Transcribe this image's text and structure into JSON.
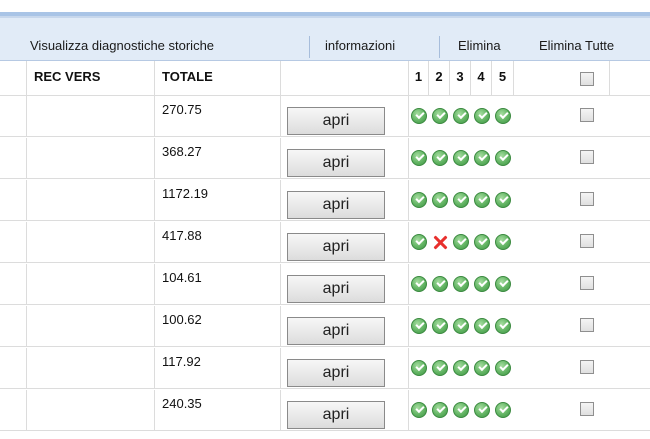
{
  "toolbar": {
    "items": [
      {
        "label": "Visualizza diagnostiche storiche"
      },
      {
        "label": "informazioni"
      },
      {
        "label": "Elimina"
      },
      {
        "label": "Elimina Tutte"
      }
    ]
  },
  "table": {
    "columns": {
      "rec_vers": "REC VERS",
      "totale": "TOTALE",
      "d1": "1",
      "d2": "2",
      "d3": "3",
      "d4": "4",
      "d5": "5"
    },
    "button_label": "apri",
    "rows": [
      {
        "totale": "270.75",
        "status": [
          "ok",
          "ok",
          "ok",
          "ok",
          "ok"
        ]
      },
      {
        "totale": "368.27",
        "status": [
          "ok",
          "ok",
          "ok",
          "ok",
          "ok"
        ]
      },
      {
        "totale": "1172.19",
        "status": [
          "ok",
          "ok",
          "ok",
          "ok",
          "ok"
        ]
      },
      {
        "totale": "417.88",
        "status": [
          "ok",
          "error",
          "ok",
          "ok",
          "ok"
        ]
      },
      {
        "totale": "104.61",
        "status": [
          "ok",
          "ok",
          "ok",
          "ok",
          "ok"
        ]
      },
      {
        "totale": "100.62",
        "status": [
          "ok",
          "ok",
          "ok",
          "ok",
          "ok"
        ]
      },
      {
        "totale": "117.92",
        "status": [
          "ok",
          "ok",
          "ok",
          "ok",
          "ok"
        ]
      },
      {
        "totale": "240.35",
        "status": [
          "ok",
          "ok",
          "ok",
          "ok",
          "ok"
        ]
      }
    ]
  },
  "colors": {
    "toolbar_bg": "#e1ebf7",
    "ok_green": "#62b463",
    "error_red": "#e8302d"
  },
  "icons": {
    "ok": "green-check-circle-icon",
    "error": "red-x-icon"
  }
}
